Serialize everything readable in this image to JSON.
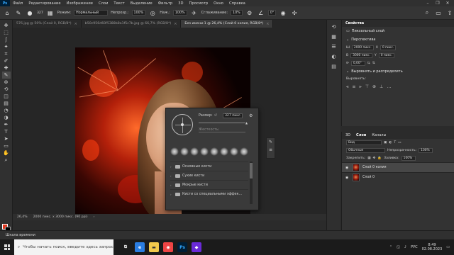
{
  "app": {
    "logo": "Ps"
  },
  "menu": [
    "Файл",
    "Редактирование",
    "Изображение",
    "Слои",
    "Текст",
    "Выделение",
    "Фильтр",
    "3D",
    "Просмотр",
    "Окно",
    "Справка"
  ],
  "options": {
    "brush_size": "327",
    "mode_label": "Режим:",
    "mode_value": "Нормальный",
    "opacity_label": "Непрозр.:",
    "opacity_value": "100%",
    "flow_label": "Наж.:",
    "flow_value": "100%",
    "smoothing_label": "Сглаживание:",
    "smoothing_value": "10%",
    "angle_value": "0°"
  },
  "tabs": [
    {
      "label": "576.jpg @ 50% (Слой 0, RGB/8*)",
      "active": false
    },
    {
      "label": "b50c956d60f5388b8a1f5c7b.jpg @ 66,7% (RGB/8*)",
      "active": false
    },
    {
      "label": "Без имени-1 @ 26,4% (Слой 0 копия, RGB/8*)",
      "active": true
    }
  ],
  "brush_picker": {
    "size_label": "Размер:",
    "size_value": "327 пикс.",
    "hardness_label": "Жесткость:",
    "folders": [
      "Основные кисти",
      "Сухие кисти",
      "Мокрые кисти",
      "Кисти со специальными эффек..."
    ]
  },
  "status": {
    "zoom": "26,4%",
    "dimensions": "2000 пикс. x 3000 пикс. (90 ppi)"
  },
  "timeline": "Шкала времени",
  "properties": {
    "tab": "Свойства",
    "layer_type": "Пиксельный слой",
    "transform_title": "Перспектива",
    "w_label": "Ш",
    "w_value": "2000 пикс.",
    "x_label": "X",
    "x_value": "0 пикс.",
    "h_label": "В",
    "h_value": "3000 пикс.",
    "y_label": "Y",
    "y_value": "0 пикс.",
    "angle_value": "0,00°",
    "align_title": "Выровнять и распределить",
    "align_sub": "Выровнять:"
  },
  "layers": {
    "tabs": [
      "3D",
      "Слои",
      "Каналы"
    ],
    "active_tab": "Слои",
    "filter_label": "Вид",
    "blend_mode": "Обычные",
    "opacity_label": "Непрозрачность:",
    "opacity_value": "100%",
    "lock_label": "Закрепить:",
    "fill_label": "Заливка:",
    "fill_value": "100%",
    "items": [
      {
        "name": "Слой 0 копия",
        "selected": true
      },
      {
        "name": "Слой 0",
        "selected": false
      }
    ]
  },
  "taskbar": {
    "search_placeholder": "Чтобы начать поиск, введите здесь запрос",
    "language": "РУС",
    "time": "8:49",
    "date": "02.08.2023"
  },
  "colors": {
    "foreground": "#e2361d",
    "background": "#000000",
    "accent": "#31a8ff"
  },
  "icons": [
    "move-icon",
    "marquee-icon",
    "lasso-icon",
    "quick-select-icon",
    "crop-icon",
    "eyedropper-icon",
    "healing-icon",
    "brush-icon",
    "stamp-icon",
    "history-brush-icon",
    "eraser-icon",
    "gradient-icon",
    "blur-icon",
    "dodge-icon",
    "pen-icon",
    "type-icon",
    "path-select-icon",
    "rectangle-icon",
    "hand-icon",
    "zoom-icon"
  ]
}
